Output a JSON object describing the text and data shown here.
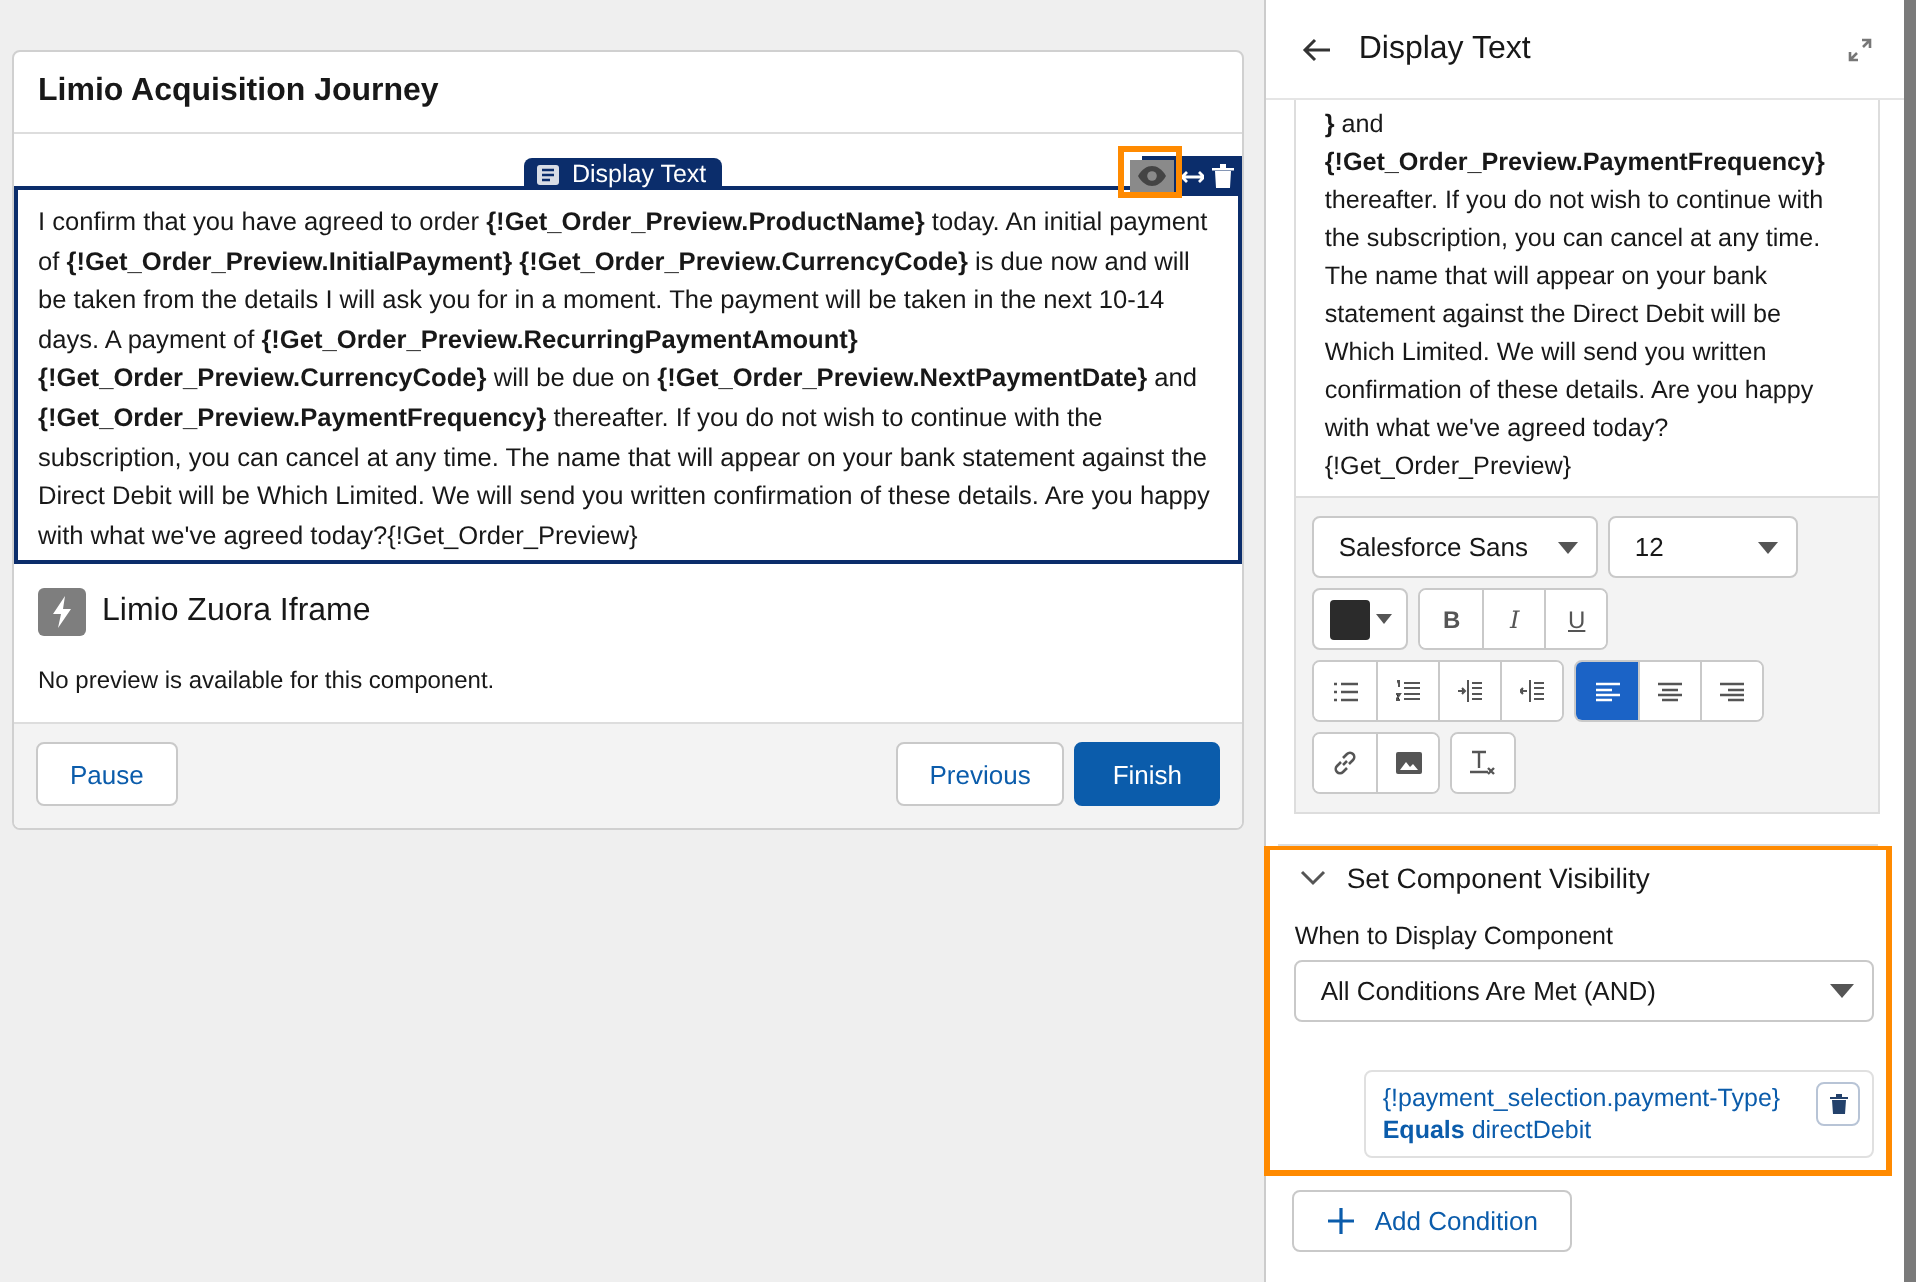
{
  "flow": {
    "title": "Limio Acquisition Journey",
    "display_text": {
      "tag": "Display Text",
      "body": "I confirm that you have agreed to order **{!Get_Order_Preview.ProductName}** today. An initial payment of **{!Get_Order_Preview.InitialPayment}** **{!Get_Order_Preview.CurrencyCode}** is due now and will be taken from the details I will ask you for in a moment. The payment will be taken in the next 10-14 days. A payment of **{!Get_Order_Preview.RecurringPaymentAmount}** **{!Get_Order_Preview.CurrencyCode}** will be due on **{!Get_Order_Preview.NextPaymentDate}** and **{!Get_Order_Preview.PaymentFrequency}** thereafter. If you do not wish to continue with the subscription, you can cancel at any time. The name that will appear on your bank statement against the Direct Debit will be Which Limited. We will send you written confirmation of these details. Are you happy with what we've agreed today?{!Get_Order_Preview}"
    },
    "component": {
      "title": "Limio Zuora Iframe",
      "message": "No preview is available for this component."
    },
    "pause": {
      "label": "Pause"
    },
    "nav": [
      {
        "label": "Previous",
        "primary": false
      },
      {
        "label": "Finish",
        "primary": true
      }
    ]
  },
  "panel": {
    "title": "Display Text",
    "editor_text": "**}** and **{!Get_Order_Preview.PaymentFrequency}** thereafter. If you do not wish to continue with the subscription, you can cancel at any time. The name that will appear on your bank statement against the Direct Debit will be Which Limited. We will send you written confirmation of these details. Are you happy with what we've agreed today?{!Get_Order_Preview}",
    "font_family": "Salesforce Sans",
    "font_size": "12",
    "toolbar": [
      [
        [
          {
            "kind": "bold",
            "label": "B",
            "selected": false
          },
          {
            "kind": "italic",
            "label": "I",
            "selected": false
          },
          {
            "kind": "underline",
            "label": "U",
            "selected": false
          }
        ]
      ],
      [
        [
          {
            "kind": "bullets",
            "selected": false
          },
          {
            "kind": "numbers",
            "selected": false
          },
          {
            "kind": "indent",
            "selected": false
          },
          {
            "kind": "outdent",
            "selected": false
          }
        ],
        [
          {
            "kind": "align-left",
            "selected": true
          },
          {
            "kind": "align-center",
            "selected": false
          },
          {
            "kind": "align-right",
            "selected": false
          }
        ]
      ],
      [
        [
          {
            "kind": "link",
            "selected": false
          },
          {
            "kind": "image",
            "selected": false
          }
        ],
        [
          {
            "kind": "clear",
            "selected": false
          }
        ]
      ]
    ],
    "visibility": {
      "title": "Set Component Visibility",
      "expanded": true,
      "field_label": "When to Display Component",
      "value": "All Conditions Are Met (AND)",
      "conditions": [
        {
          "text": "{!payment_selection.payment-Type} **Equals** directDebit"
        }
      ]
    },
    "add_button": "Add Condition"
  }
}
